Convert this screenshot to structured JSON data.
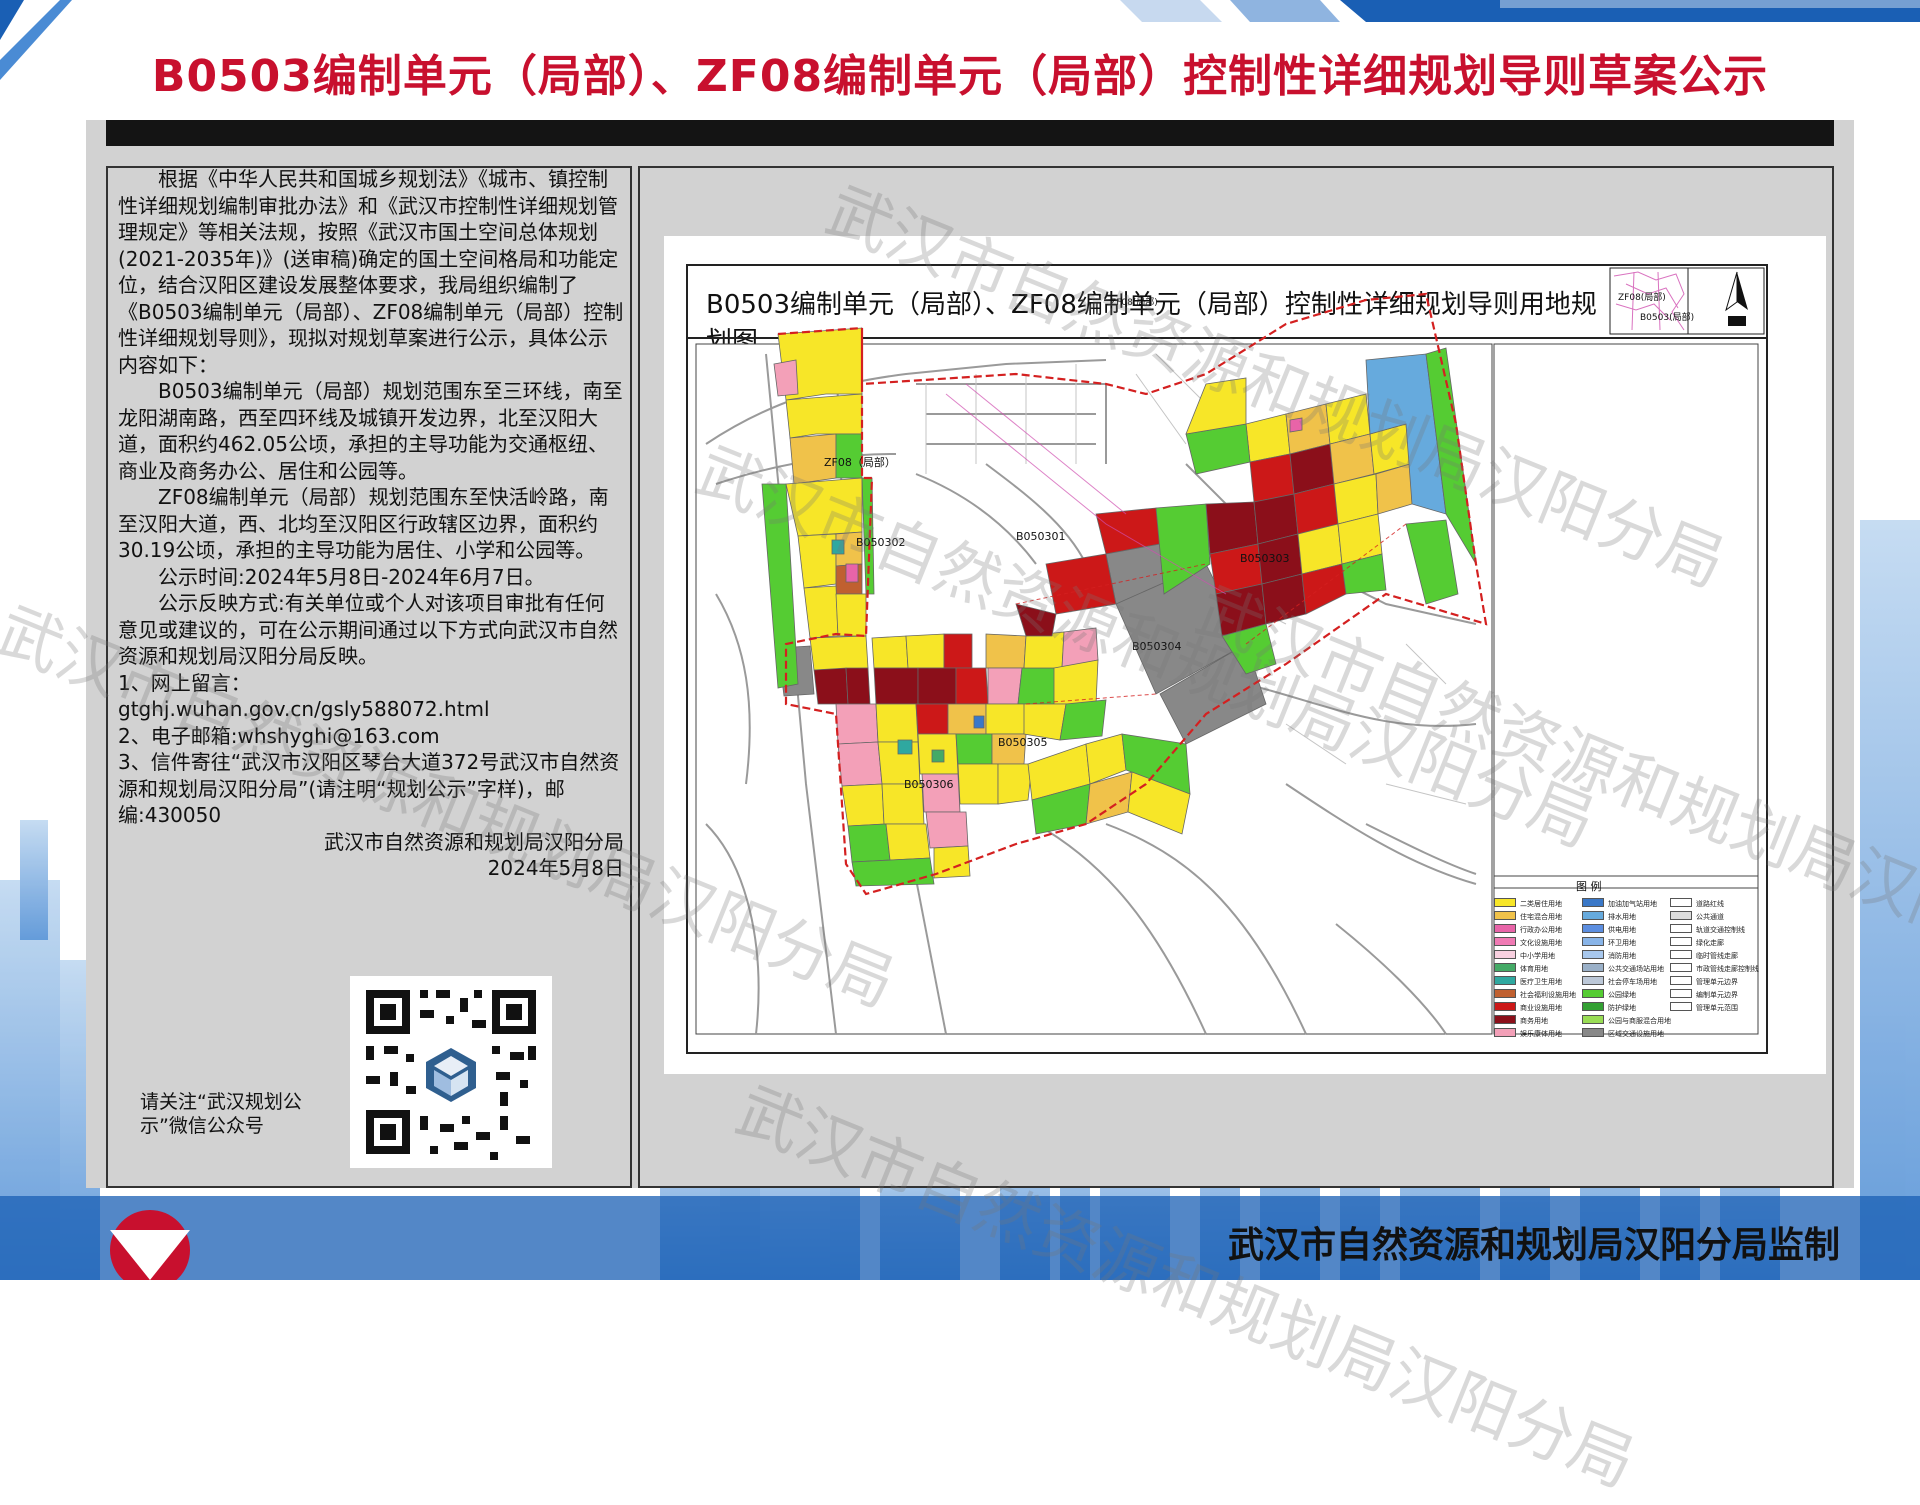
{
  "title": "B0503编制单元（局部）、ZF08编制单元（局部）控制性详细规划导则草案公示",
  "notice": {
    "paragraphs": [
      "根据《中华人民共和国城乡规划法》《城市、镇控制性详细规划编制审批办法》和《武汉市控制性详细规划管理规定》等相关法规，按照《武汉市国土空间总体规划(2021-2035年)》(送审稿)确定的国土空间格局和功能定位，结合汉阳区建设发展整体要求，我局组织编制了《B0503编制单元（局部）、ZF08编制单元（局部）控制性详细规划导则》，现拟对规划草案进行公示，具体公示内容如下：",
      "B0503编制单元（局部）规划范围东至三环线，南至龙阳湖南路，西至四环线及城镇开发边界，北至汉阳大道，面积约462.05公顷，承担的主导功能为交通枢纽、商业及商务办公、居住和公园等。",
      "ZF08编制单元（局部）规划范围东至快活岭路，南至汉阳大道，西、北均至汉阳区行政辖区边界，面积约30.19公顷，承担的主导功能为居住、小学和公园等。",
      "公示时间:2024年5月8日-2024年6月7日。",
      "公示反映方式:有关单位或个人对该项目审批有任何意见或建议的，可在公示期间通过以下方式向武汉市自然资源和规划局汉阳分局反映。"
    ],
    "channels": [
      "1、网上留言：",
      "gtghj.wuhan.gov.cn/gsly588072.html",
      "2、电子邮箱:whshyghi@163.com",
      "3、信件寄往“武汉市汉阳区琴台大道372号武汉市自然资源和规划局汉阳分局”(请注明“规划公示”字样)，邮编:430050"
    ],
    "signature": "武汉市自然资源和规划局汉阳分局",
    "date": "2024年5月8日"
  },
  "qr_caption": "请关注“武汉规划公示”微信公众号",
  "map": {
    "title": "B0503编制单元（局部）、ZF08编制单元（局部）控制性详细规划导则用地规划图",
    "inset_labels": [
      "ZF08(局部)",
      "B0503(局部)"
    ],
    "unit_labels": [
      "ZF08（局部）",
      "B050302",
      "B050301",
      "B050303",
      "B050304",
      "B050305",
      "B050306"
    ],
    "legend_title": "图 例",
    "legend_items": [
      {
        "label": "二类居住用地",
        "color": "#f7e628"
      },
      {
        "label": "住宅混合用地",
        "color": "#f0c24a"
      },
      {
        "label": "行政办公用地",
        "color": "#e864a8"
      },
      {
        "label": "文化设施用地",
        "color": "#f07ab4"
      },
      {
        "label": "中小学用地",
        "color": "#f8d0e0"
      },
      {
        "label": "体育用地",
        "color": "#44aa66"
      },
      {
        "label": "医疗卫生用地",
        "color": "#2fa8a0"
      },
      {
        "label": "社会福利设施用地",
        "color": "#c06030"
      },
      {
        "label": "商业设施用地",
        "color": "#cc1818"
      },
      {
        "label": "商务用地",
        "color": "#8b0f1a"
      },
      {
        "label": "娱乐康体用地",
        "color": "#f3a0b8"
      },
      {
        "label": "加油加气站用地",
        "color": "#3a78c8"
      },
      {
        "label": "排水用地",
        "color": "#66aadd"
      },
      {
        "label": "供电用地",
        "color": "#5c8ee0"
      },
      {
        "label": "环卫用地",
        "color": "#88b4e8"
      },
      {
        "label": "消防用地",
        "color": "#a8c8ee"
      },
      {
        "label": "公共交通场站用地",
        "color": "#9ab0c8"
      },
      {
        "label": "社会停车场用地",
        "color": "#bcc8d8"
      },
      {
        "label": "公园绿地",
        "color": "#55cc33"
      },
      {
        "label": "防护绿地",
        "color": "#33a033"
      },
      {
        "label": "公园与商服混合用地",
        "color": "#99dd55"
      },
      {
        "label": "区域交通设施用地",
        "color": "#888888"
      },
      {
        "label": "道路红线",
        "color": "#ffffff"
      },
      {
        "label": "公共通道",
        "color": "#dddddd"
      },
      {
        "label": "轨道交通控制线",
        "color": "#ffffff"
      },
      {
        "label": "绿化走廊",
        "color": "#ffffff"
      },
      {
        "label": "临时管线走廊",
        "color": "#ffffff"
      },
      {
        "label": "市政管线走廊控制线",
        "color": "#ffffff"
      },
      {
        "label": "管理单元边界",
        "color": "#ffffff"
      },
      {
        "label": "编制单元边界",
        "color": "#ffffff"
      },
      {
        "label": "管理单元范围",
        "color": "#ffffff"
      }
    ]
  },
  "watermark": "武汉市自然资源和规划局汉阳分局",
  "footer": "武汉市自然资源和规划局汉阳分局监制",
  "colors": {
    "title": "#c8102e",
    "accent": "#1a5fb4",
    "board": "#d2d2d2"
  }
}
